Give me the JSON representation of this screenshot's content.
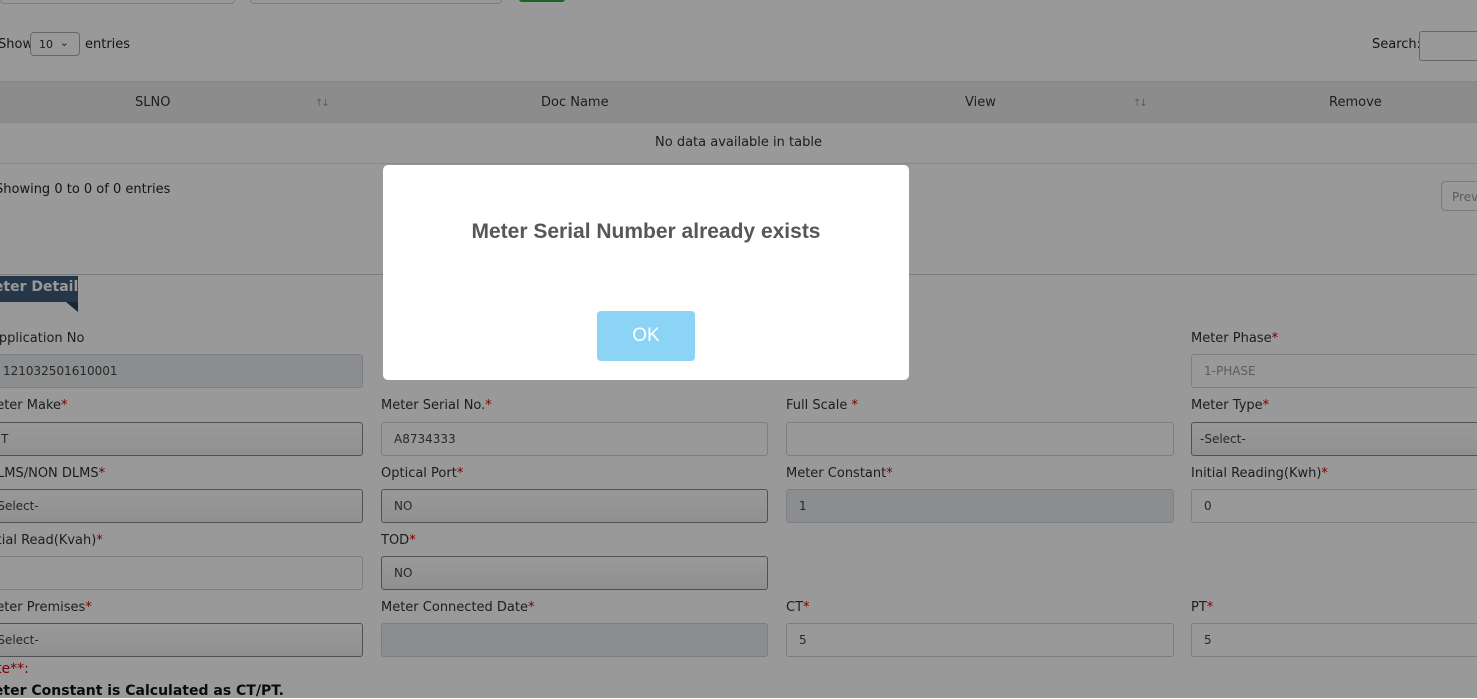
{
  "table_controls": {
    "show_label": "Show",
    "length_value": "10",
    "entries_label": "entries",
    "search_label": "Search:",
    "search_value": ""
  },
  "table": {
    "columns": [
      "SLNO",
      "Doc Name",
      "View",
      "Remove"
    ],
    "empty_message": "No data available in table",
    "info": "Showing 0 to 0 of 0 entries",
    "prev_label": "Previous"
  },
  "section": {
    "title": "Meter Details"
  },
  "form": {
    "application_no": {
      "label": "Application No",
      "value": "121032501610001"
    },
    "meter_phase": {
      "label": "Meter Phase",
      "value": "1-PHASE"
    },
    "meter_make": {
      "label": "Meter Make",
      "value": "T"
    },
    "meter_serial_no": {
      "label": "Meter Serial No.",
      "value": "A8734333"
    },
    "full_scale": {
      "label": "Full Scale ",
      "value": ""
    },
    "meter_type": {
      "label": "Meter Type",
      "value": "-Select-"
    },
    "dlms": {
      "label": "DLMS/NON DLMS",
      "value": "-Select-"
    },
    "optical_port": {
      "label": "Optical Port",
      "value": "NO"
    },
    "meter_constant": {
      "label": "Meter Constant",
      "value": "1"
    },
    "initial_reading_kwh": {
      "label": "Initial Reading(Kwh)",
      "value": "0"
    },
    "initial_read_kvah": {
      "label": "Initial Read(Kvah)",
      "value": ""
    },
    "tod": {
      "label": "TOD",
      "value": "NO"
    },
    "meter_premises": {
      "label": "Meter Premises",
      "value": "-Select-"
    },
    "meter_connected_date": {
      "label": "Meter Connected Date",
      "value": ""
    },
    "ct": {
      "label": "CT",
      "value": "5"
    },
    "pt": {
      "label": "PT",
      "value": "5"
    }
  },
  "note": {
    "title": "Note**:",
    "text": "Meter Constant is Calculated as CT/PT."
  },
  "dialog": {
    "message": "Meter Serial Number already exists",
    "ok_label": "OK"
  },
  "colors": {
    "section_tab": "#3c5a78",
    "required": "#cc0000",
    "ok_button": "#8cd4f5",
    "top_button": "#28a745"
  }
}
